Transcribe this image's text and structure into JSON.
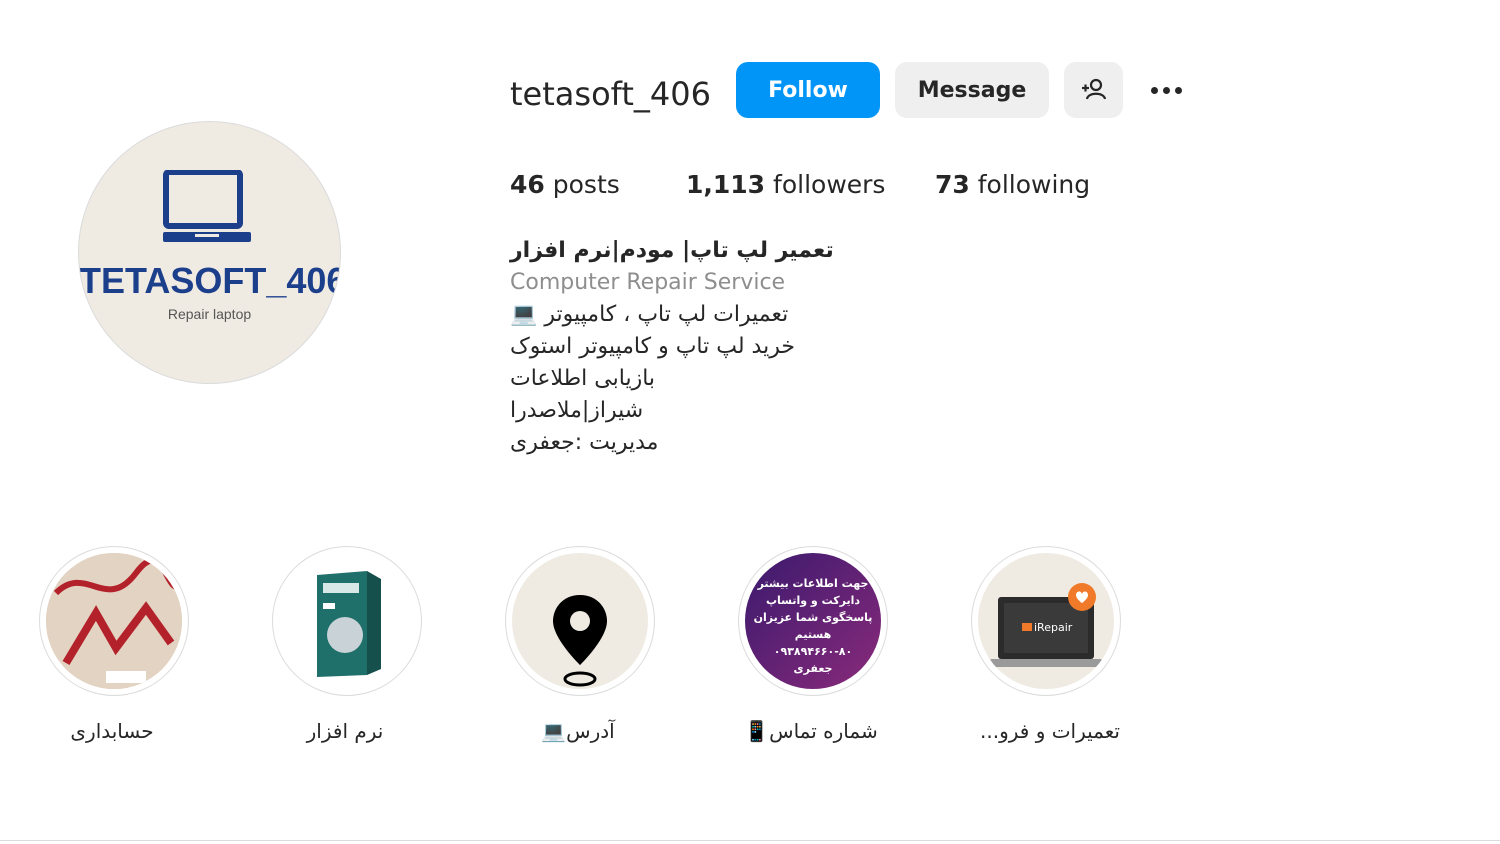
{
  "profile": {
    "username": "tetasoft_406",
    "avatar": {
      "logo_text": "TETASOFT_406",
      "logo_subtext": "Repair laptop",
      "logo_color": "#1c3f8c",
      "background": "#efebe3"
    }
  },
  "actions": {
    "follow_label": "Follow",
    "message_label": "Message",
    "add_user_icon": "person-add-icon",
    "more_icon": "more-options-icon",
    "follow_color": "#0095f6"
  },
  "stats": {
    "posts_count": "46",
    "posts_label": "posts",
    "followers_count": "1,113",
    "followers_label": "followers",
    "following_count": "73",
    "following_label": "following"
  },
  "bio": {
    "name": "تعمیر لپ تاپ| مودم|نرم افزار",
    "category": "Computer Repair Service",
    "lines": [
      "تعمیرات لپ تاپ ، کامپیوتر 💻",
      "خرید لپ تاپ و کامپیوتر استوک",
      "بازیابی اطلاعات",
      "شیراز|ملاصدرا",
      "مدیریت :جعفری"
    ]
  },
  "highlights": [
    {
      "label": "حسابداری",
      "thumb": "accounting-thumbnail"
    },
    {
      "label": "نرم افزار",
      "thumb": "software-box-thumbnail"
    },
    {
      "label": "آدرس💻",
      "thumb": "location-pin-icon"
    },
    {
      "label": "شماره تماس📱",
      "thumb": "contact-info-thumbnail",
      "thumb_text": [
        "جهت اطلاعات بیشتر",
        "دایرکت و واتساپ",
        "پاسخگوی شما عزیزان",
        "هستیم",
        "۰۹۳۸۹۴۶۶۰-۸۰",
        "جعفری"
      ]
    },
    {
      "label": "تعمیرات و فرو...",
      "thumb": "irepair-laptop-thumbnail",
      "thumb_text": [
        "iRepair"
      ]
    }
  ]
}
